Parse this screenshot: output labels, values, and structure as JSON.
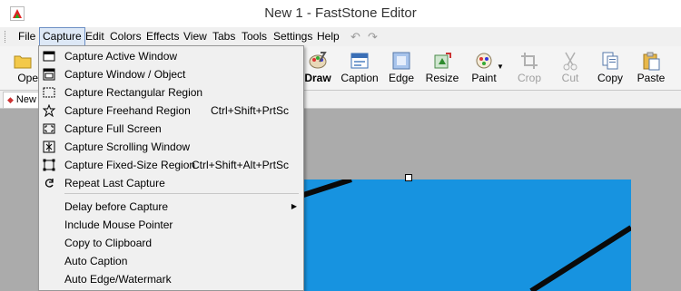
{
  "window": {
    "title": "New 1 - FastStone Editor"
  },
  "menubar": {
    "items": [
      "File",
      "Capture",
      "Edit",
      "Colors",
      "Effects",
      "View",
      "Tabs",
      "Tools",
      "Settings",
      "Help"
    ],
    "active": "Capture"
  },
  "toolbar": {
    "open_label": "Ope",
    "draw_label": "Draw",
    "caption_label": "Caption",
    "edge_label": "Edge",
    "resize_label": "Resize",
    "paint_label": "Paint",
    "crop_label": "Crop",
    "cut_label": "Cut",
    "copy_label": "Copy",
    "paste_label": "Paste"
  },
  "tabs": {
    "current": "New"
  },
  "capture_menu": {
    "items": [
      {
        "label": "Capture Active Window",
        "shortcut": ""
      },
      {
        "label": "Capture Window / Object",
        "shortcut": ""
      },
      {
        "label": "Capture Rectangular Region",
        "shortcut": ""
      },
      {
        "label": "Capture Freehand Region",
        "shortcut": "Ctrl+Shift+PrtSc"
      },
      {
        "label": "Capture Full Screen",
        "shortcut": ""
      },
      {
        "label": "Capture Scrolling Window",
        "shortcut": ""
      },
      {
        "label": "Capture Fixed-Size Region",
        "shortcut": "Ctrl+Shift+Alt+PrtSc"
      },
      {
        "label": "Repeat Last Capture",
        "shortcut": ""
      },
      {
        "label": "Delay before Capture",
        "shortcut": ""
      },
      {
        "label": "Include Mouse Pointer",
        "shortcut": ""
      },
      {
        "label": "Copy to Clipboard",
        "shortcut": ""
      },
      {
        "label": "Auto Caption",
        "shortcut": ""
      },
      {
        "label": "Auto Edge/Watermark",
        "shortcut": ""
      }
    ]
  }
}
